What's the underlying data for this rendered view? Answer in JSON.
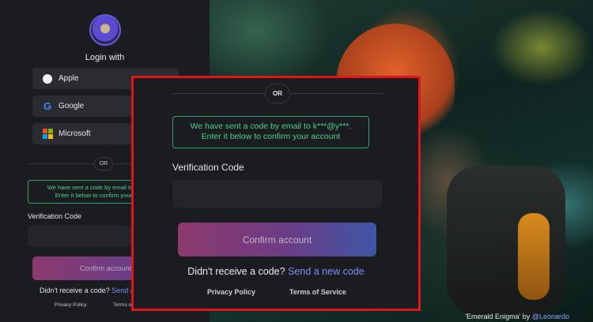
{
  "login": {
    "heading": "Login with",
    "providers": [
      {
        "label": "Apple",
        "icon": "apple-icon"
      },
      {
        "label": "Google",
        "icon": "google-icon"
      },
      {
        "label": "Microsoft",
        "icon": "microsoft-icon"
      }
    ],
    "divider": "OR",
    "notice_line1": "We have sent a code by email to k***@y***.",
    "notice_line2": "Enter it below to confirm your account",
    "code_label": "Verification Code",
    "code_value": "",
    "confirm_button": "Confirm account",
    "resend_prompt": "Didn't receive a code?",
    "resend_link": "Send a new code",
    "footer": {
      "privacy": "Privacy Policy",
      "terms": "Terms of Service"
    }
  },
  "credit": {
    "title": "'Emerald Enigma' by",
    "author": "@Leonardo"
  },
  "colors": {
    "accent_green": "#4bd48a",
    "link": "#7f8dff",
    "highlight_border": "#e0161c",
    "button_start": "#8d3a6c",
    "button_end": "#3f56a6"
  }
}
